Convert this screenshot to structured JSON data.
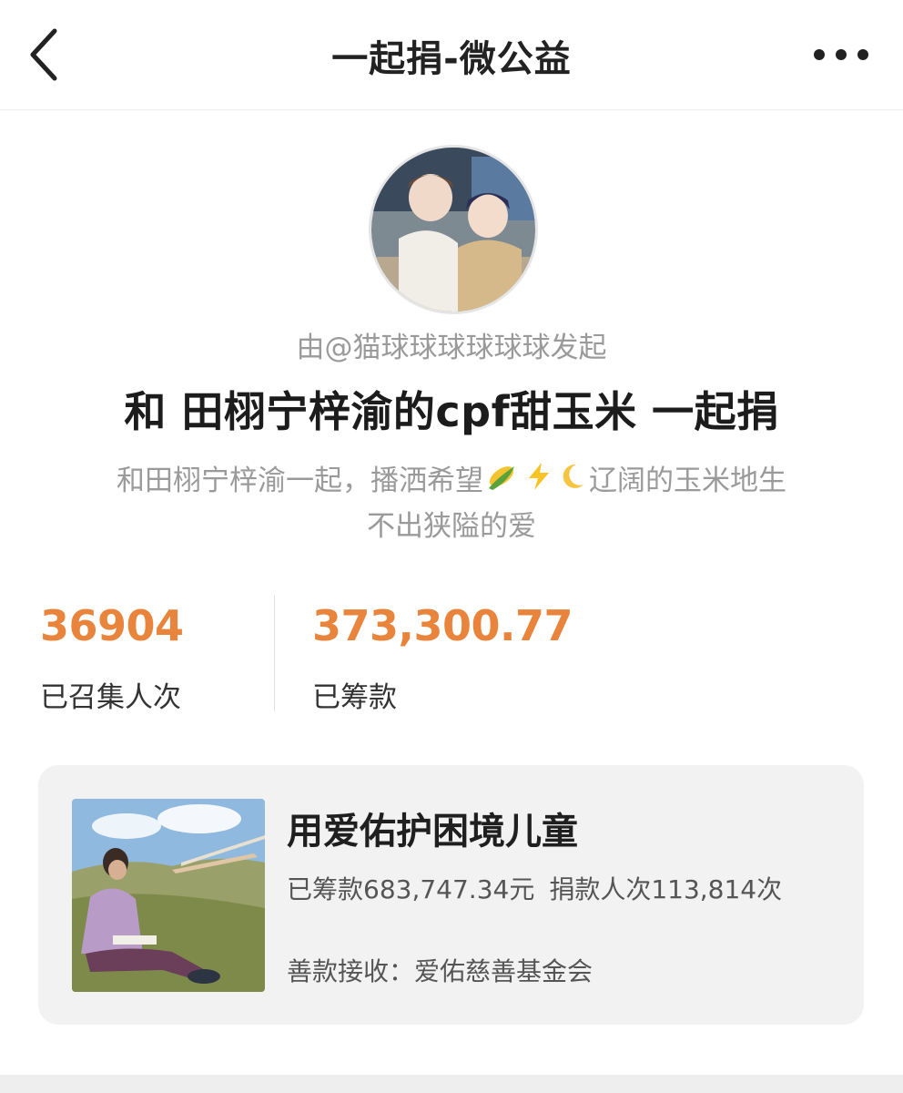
{
  "nav": {
    "title": "一起捐-微公益",
    "back_icon": "chevron-left-icon",
    "more_icon": "more-horizontal-icon"
  },
  "campaign": {
    "initiator": "由@猫球球球球球球发起",
    "headline": "和 田栩宁梓渝的cpf甜玉米 一起捐",
    "description_part1": "和田栩宁梓渝一起，播洒希望",
    "description_emojis": [
      "corn-emoji",
      "lightning-emoji",
      "crescent-moon-emoji"
    ],
    "description_part2": "辽阔的玉米地生",
    "description_line2": "不出狭隘的爱"
  },
  "stats": {
    "participants_value": "36904",
    "participants_label": "已召集人次",
    "raised_value": "373,300.77",
    "raised_label": "已筹款"
  },
  "project": {
    "title": "用爱佑护困境儿童",
    "raised_text": "已筹款683,747.34元",
    "donors_text": "捐款人次113,814次",
    "receiver_text": "善款接收：爱佑慈善基金会"
  },
  "colors": {
    "accent": "#e8843c",
    "card_bg": "#f2f2f2",
    "muted_text": "#9a9a9a"
  }
}
